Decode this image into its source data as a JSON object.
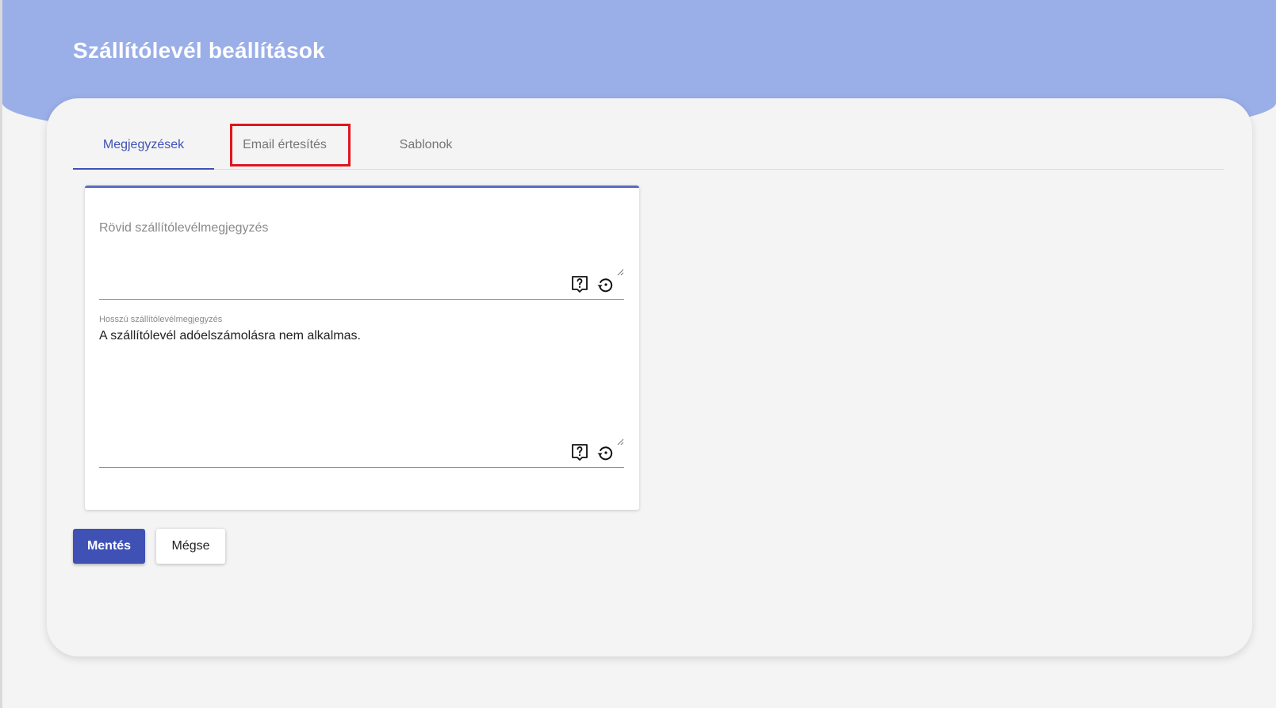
{
  "page": {
    "title": "Szállítólevél beállítások"
  },
  "tabs": [
    {
      "label": "Megjegyzések",
      "active": true
    },
    {
      "label": "Email értesítés",
      "active": false
    },
    {
      "label": "Sablonok",
      "active": false
    }
  ],
  "form": {
    "short_note": {
      "label": "Rövid szállítólevélmegjegyzés",
      "value": ""
    },
    "long_note": {
      "label": "Hosszú szállítólevélmegjegyzés",
      "value": "A szállítólevél adóelszámolásra nem alkalmas."
    }
  },
  "actions": {
    "save_label": "Mentés",
    "cancel_label": "Mégse"
  },
  "icons": {
    "help": "help-question-icon",
    "reset": "restore-default-icon"
  },
  "colors": {
    "header": "#9aaee8",
    "primary": "#3f51b5",
    "highlight": "#e0151e"
  }
}
